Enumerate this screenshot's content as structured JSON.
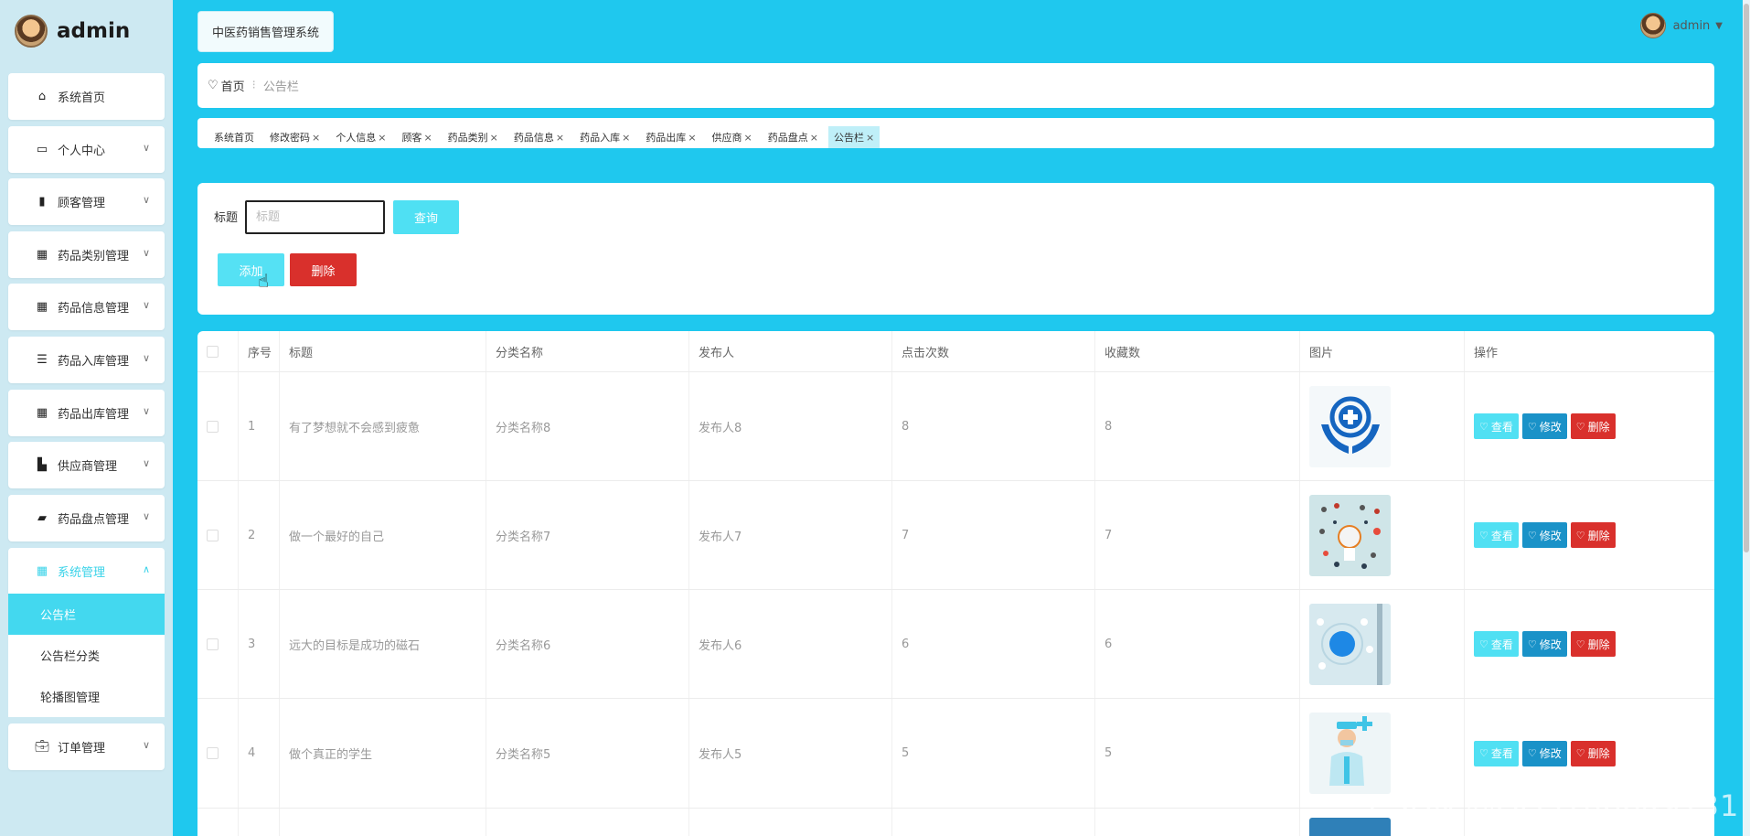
{
  "brand": {
    "title": "admin"
  },
  "app_title": "中医药销售管理系统",
  "user": {
    "name": "admin"
  },
  "sidebar": {
    "items": [
      {
        "label": "系统首页",
        "icon": "home-icon"
      },
      {
        "label": "个人中心",
        "icon": "card-icon"
      },
      {
        "label": "顾客管理",
        "icon": "bar-chart-icon"
      },
      {
        "label": "药品类别管理",
        "icon": "grid-icon"
      },
      {
        "label": "药品信息管理",
        "icon": "grid-icon"
      },
      {
        "label": "药品入库管理",
        "icon": "list-icon"
      },
      {
        "label": "药品出库管理",
        "icon": "grid-icon"
      },
      {
        "label": "供应商管理",
        "icon": "building-icon"
      },
      {
        "label": "药品盘点管理",
        "icon": "wallet-icon"
      },
      {
        "label": "系统管理",
        "icon": "grid-icon"
      },
      {
        "label": "订单管理",
        "icon": "briefcase-icon"
      }
    ],
    "submenu": [
      {
        "label": "公告栏"
      },
      {
        "label": "公告栏分类"
      },
      {
        "label": "轮播图管理"
      }
    ]
  },
  "breadcrumb": {
    "home": "首页",
    "current": "公告栏"
  },
  "tags": [
    {
      "label": "系统首页",
      "closable": false
    },
    {
      "label": "修改密码",
      "closable": true
    },
    {
      "label": "个人信息",
      "closable": true
    },
    {
      "label": "顾客",
      "closable": true
    },
    {
      "label": "药品类别",
      "closable": true
    },
    {
      "label": "药品信息",
      "closable": true
    },
    {
      "label": "药品入库",
      "closable": true
    },
    {
      "label": "药品出库",
      "closable": true
    },
    {
      "label": "供应商",
      "closable": true
    },
    {
      "label": "药品盘点",
      "closable": true
    },
    {
      "label": "公告栏",
      "closable": true
    }
  ],
  "filter": {
    "label": "标题",
    "placeholder": "标题",
    "query_label": "查询",
    "add_label": "添加",
    "delete_label": "删除"
  },
  "table": {
    "columns": [
      "序号",
      "标题",
      "分类名称",
      "发布人",
      "点击次数",
      "收藏数",
      "图片",
      "操作"
    ],
    "rows": [
      {
        "index": "1",
        "title": "有了梦想就不会感到疲惫",
        "category": "分类名称8",
        "publisher": "发布人8",
        "clicks": "8",
        "favorites": "8",
        "image": "medical-hands-cross-image"
      },
      {
        "index": "2",
        "title": "做一个最好的自己",
        "category": "分类名称7",
        "publisher": "发布人7",
        "clicks": "7",
        "favorites": "7",
        "image": "medical-icons-collage-image"
      },
      {
        "index": "3",
        "title": "远大的目标是成功的磁石",
        "category": "分类名称6",
        "publisher": "发布人6",
        "clicks": "6",
        "favorites": "6",
        "image": "medical-tech-circle-image"
      },
      {
        "index": "4",
        "title": "做个真正的学生",
        "category": "分类名称5",
        "publisher": "发布人5",
        "clicks": "5",
        "favorites": "5",
        "image": "doctor-illustration-image"
      }
    ],
    "actions": {
      "view": "查看",
      "edit": "修改",
      "delete": "删除"
    }
  },
  "watermark": "CSDN @QQ3786649731",
  "colors": {
    "accent": "#4fe0f3",
    "danger": "#d9302c",
    "edit": "#1a92c8",
    "background": "#1fc8ee"
  }
}
